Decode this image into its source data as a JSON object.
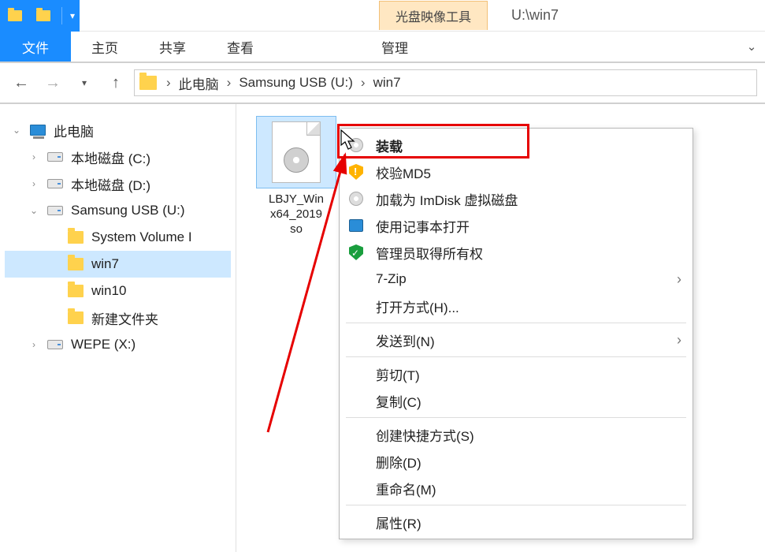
{
  "titlebar": {
    "tools_tab": "光盘映像工具",
    "window_title": "U:\\win7"
  },
  "ribbon": {
    "file": "文件",
    "tabs": [
      "主页",
      "共享",
      "查看"
    ],
    "context_tab": "管理"
  },
  "breadcrumb": {
    "items": [
      "此电脑",
      "Samsung USB (U:)",
      "win7"
    ]
  },
  "tree": {
    "root": "此电脑",
    "drives": [
      {
        "label": "本地磁盘 (C:)",
        "type": "drive"
      },
      {
        "label": "本地磁盘 (D:)",
        "type": "drive"
      },
      {
        "label": "Samsung USB (U:)",
        "type": "drive",
        "expanded": true,
        "children": [
          {
            "label": "System Volume I",
            "type": "folder"
          },
          {
            "label": "win7",
            "type": "folder",
            "selected": true
          },
          {
            "label": "win10",
            "type": "folder"
          },
          {
            "label": "新建文件夹",
            "type": "folder"
          }
        ]
      },
      {
        "label": "WEPE (X:)",
        "type": "drive"
      }
    ]
  },
  "content": {
    "files": [
      {
        "name_line1": "LBJY_Win",
        "name_line2": "x64_2019",
        "name_line3": "so",
        "selected": true
      }
    ]
  },
  "context_menu": {
    "items": [
      {
        "label": "装载",
        "icon": "disc",
        "bold": true
      },
      {
        "label": "校验MD5",
        "icon": "shield-warn"
      },
      {
        "label": "加载为 ImDisk 虚拟磁盘",
        "icon": "disc"
      },
      {
        "label": "使用记事本打开",
        "icon": "disk-blue"
      },
      {
        "label": "管理员取得所有权",
        "icon": "shield-ok"
      },
      {
        "label": "7-Zip",
        "submenu": true
      },
      {
        "label": "打开方式(H)..."
      },
      {
        "sep": true
      },
      {
        "label": "发送到(N)",
        "submenu": true
      },
      {
        "sep": true
      },
      {
        "label": "剪切(T)"
      },
      {
        "label": "复制(C)"
      },
      {
        "sep": true
      },
      {
        "label": "创建快捷方式(S)"
      },
      {
        "label": "删除(D)"
      },
      {
        "label": "重命名(M)"
      },
      {
        "sep": true
      },
      {
        "label": "属性(R)"
      }
    ]
  }
}
